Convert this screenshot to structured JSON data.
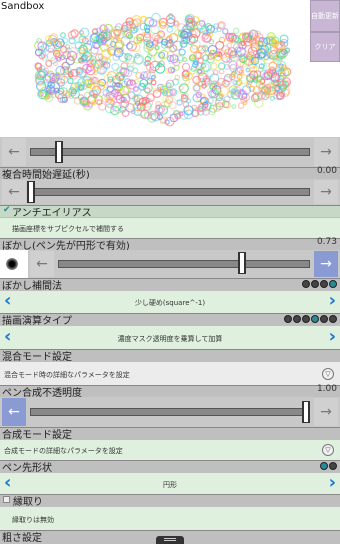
{
  "canvas": {
    "title": "Sandbox"
  },
  "side_buttons": {
    "auto": "自動更新",
    "clear": "クリア"
  },
  "rows": {
    "compose_delay": {
      "label": "複合時間始遅延(秒)",
      "value": "0.00"
    },
    "antialias": {
      "label": "アンチエイリアス",
      "desc": "描画座標をサブピクセルで補間する"
    },
    "blur": {
      "label": "ぼかし(ペン先が円形で有効)",
      "value": "0.73",
      "level": 0.73
    },
    "blur_interp": {
      "label": "ぼかし補間法",
      "value": "少し硬め(square^-1)"
    },
    "draw_type": {
      "label": "描画演算タイプ",
      "value": "濃度マスク透明度を乗算して加算"
    },
    "blend_mode": {
      "label": "混合モード設定",
      "desc": "混合モード時の詳細なパラメータを設定"
    },
    "pen_opacity": {
      "label": "ペン合成不透明度",
      "value": "1.00",
      "level": 1.0
    },
    "composite_mode": {
      "label": "合成モード設定",
      "desc": "合成モードの詳細なパラメータを設定"
    },
    "pen_shape": {
      "label": "ペン先形状",
      "value": "円形"
    },
    "border": {
      "label": "縁取り",
      "desc": "縁取りは無効"
    },
    "roughness": {
      "label": "粗さ設定"
    }
  },
  "icons": {
    "left_arrow": "←",
    "right_arrow": "→",
    "chevron_left": "‹",
    "chevron_right": "›",
    "settings": "▽",
    "check": "✔"
  }
}
